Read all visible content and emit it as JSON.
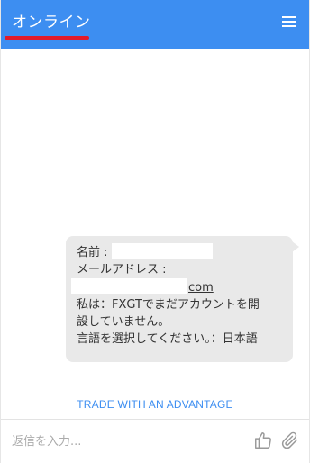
{
  "header": {
    "title": "オンライン",
    "background_color": "#3d8ef1",
    "underline_color": "#e21b2a",
    "menu_icon": "hamburger-menu-icon"
  },
  "message": {
    "name_label": "名前 :",
    "email_label": "メールアドレス :",
    "email_suffix": "com",
    "line_private_1": "私は：FXGTでまだアカウントを開",
    "line_private_2": "設していません。",
    "line_language": "言語を選択してください。：日本語"
  },
  "brand_link": "TRADE WITH AN ADVANTAGE",
  "composer": {
    "placeholder": "返信を入力...",
    "like_icon": "thumbs-up-icon",
    "attach_icon": "paperclip-icon"
  }
}
